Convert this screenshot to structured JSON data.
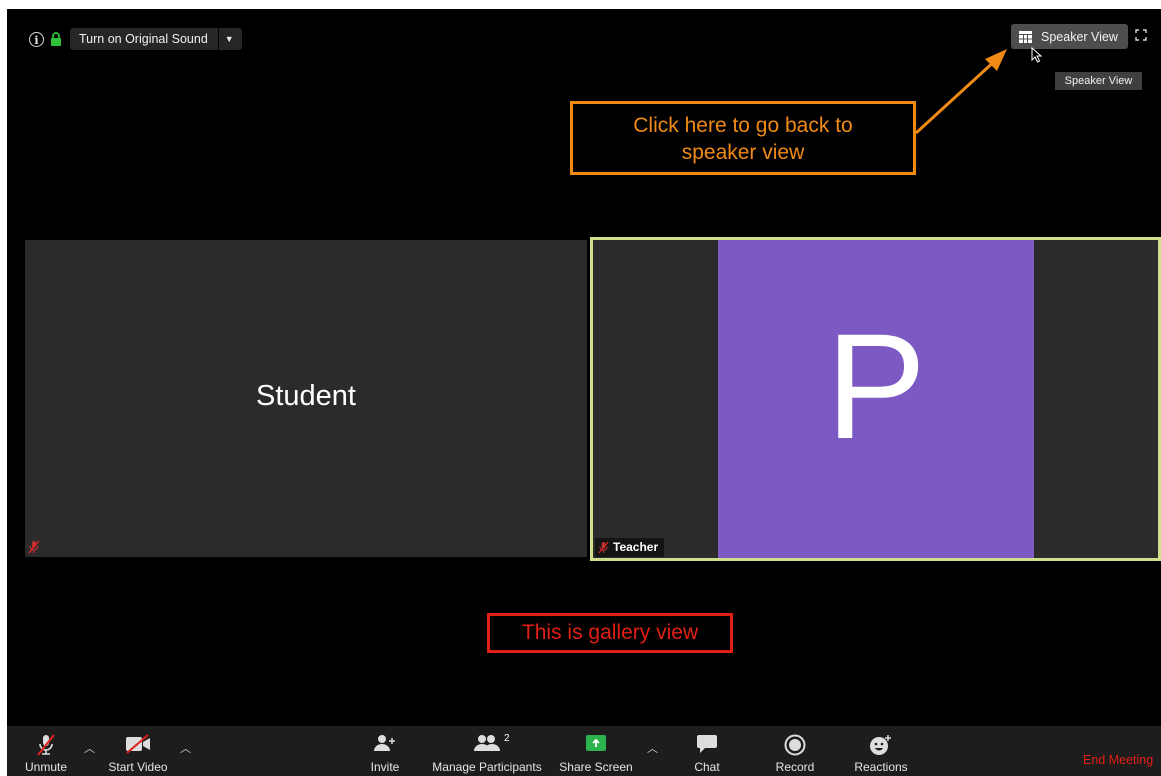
{
  "topbar": {
    "original_sound_label": "Turn on Original Sound",
    "speaker_view_label": "Speaker View",
    "tooltip": "Speaker View"
  },
  "annotations": {
    "speaker_callout": "Click here to go back to speaker view",
    "speaker_callout_line1": "Click here to go back to",
    "speaker_callout_line2": "speaker view",
    "gallery_callout": "This is gallery view",
    "orange": "#ef8a14",
    "red": "#e21f14"
  },
  "tiles": {
    "student": {
      "name": "Student"
    },
    "teacher": {
      "name": "Teacher",
      "avatar_letter": "P",
      "avatar_color": "#7d5ac3",
      "highlight_color": "#cfe08a"
    }
  },
  "toolbar": {
    "unmute": "Unmute",
    "start_video": "Start Video",
    "invite": "Invite",
    "manage_participants": "Manage Participants",
    "participant_count": "2",
    "share_screen": "Share Screen",
    "chat": "Chat",
    "record": "Record",
    "reactions": "Reactions",
    "end_meeting": "End Meeting"
  },
  "icons": [
    "info-icon",
    "lock-icon",
    "dropdown-caret-icon",
    "gallery-grid-icon",
    "fullscreen-icon",
    "cursor-icon",
    "muted-mic-icon",
    "video-off-icon",
    "invite-icon",
    "participants-icon",
    "share-screen-icon",
    "chat-icon",
    "record-icon",
    "reactions-icon"
  ]
}
